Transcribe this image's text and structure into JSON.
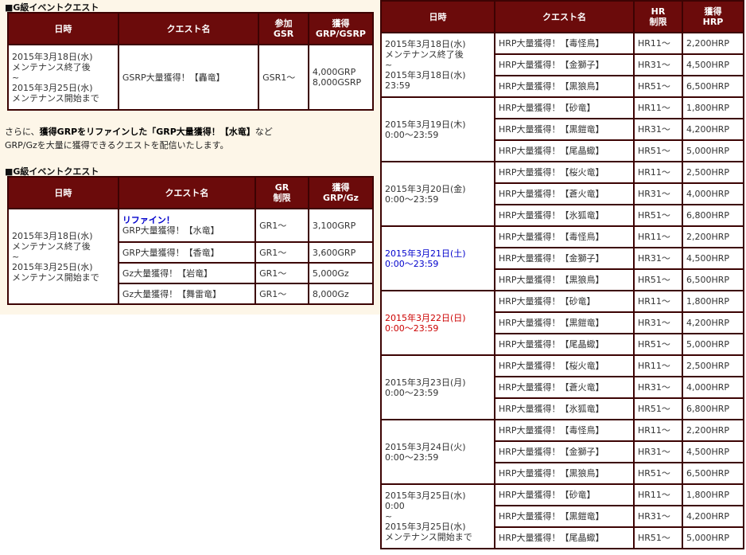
{
  "left": {
    "section1_title": "■G級イベントクエスト",
    "table1": {
      "headers": {
        "date": "日時",
        "quest": "クエスト名",
        "cond_line1": "参加",
        "cond_line2": "GSR",
        "reward_line1": "獲得",
        "reward_line2": "GRP/GSRP"
      },
      "row": {
        "date_lines": [
          "2015年3月18日(水)",
          "メンテナンス終了後",
          "~",
          "2015年3月25日(水)",
          "メンテナンス開始まで"
        ],
        "quest": "GSRP大量獲得！【轟竜】",
        "cond": "GSR1～",
        "reward_lines": [
          "4,000GRP",
          "8,000GSRP"
        ]
      }
    },
    "note": {
      "prefix": "さらに、",
      "bold1": "獲得GRPをリファインした「GRP大量獲得！【水竜】",
      "suffix": "など",
      "line2": "GRP/Gzを大量に獲得できるクエストを配信いたします。"
    },
    "section2_title": "■G級イベントクエスト",
    "table2": {
      "headers": {
        "date": "日時",
        "quest": "クエスト名",
        "cond_line1": "GR",
        "cond_line2": "制限",
        "reward_line1": "獲得",
        "reward_line2": "GRP/Gz"
      },
      "date_lines": [
        "2015年3月18日(水)",
        "メンテナンス終了後",
        "~",
        "2015年3月25日(水)",
        "メンテナンス開始まで"
      ],
      "refine_label": "リファイン！",
      "rows": [
        {
          "quest": "GRP大量獲得！【水竜】",
          "cond": "GR1～",
          "reward": "3,100GRP"
        },
        {
          "quest": "GRP大量獲得！【香竜】",
          "cond": "GR1～",
          "reward": "3,600GRP"
        },
        {
          "quest": "Gz大量獲得！【岩竜】",
          "cond": "GR1～",
          "reward": "5,000Gz"
        },
        {
          "quest": "Gz大量獲得！【舞雷竜】",
          "cond": "GR1～",
          "reward": "8,000Gz"
        }
      ]
    }
  },
  "right": {
    "headers": {
      "date": "日時",
      "quest": "クエスト名",
      "cond_line1": "HR",
      "cond_line2": "制限",
      "reward_line1": "獲得",
      "reward_line2": "HRP"
    },
    "days": [
      {
        "date_lines": [
          "2015年3月18日(水)",
          "メンテナンス終了後",
          "~",
          "2015年3月18日(水)",
          "23:59"
        ],
        "color": "#333333",
        "quests": [
          {
            "quest": "HRP大量獲得！【毒怪鳥】",
            "cond": "HR11～",
            "reward": "2,200HRP"
          },
          {
            "quest": "HRP大量獲得！【金獅子】",
            "cond": "HR31～",
            "reward": "4,500HRP"
          },
          {
            "quest": "HRP大量獲得！【黒狼鳥】",
            "cond": "HR51～",
            "reward": "6,500HRP"
          }
        ]
      },
      {
        "date_lines": [
          "2015年3月19日(木)",
          "0:00～23:59"
        ],
        "color": "#333333",
        "quests": [
          {
            "quest": "HRP大量獲得！【砂竜】",
            "cond": "HR11～",
            "reward": "1,800HRP"
          },
          {
            "quest": "HRP大量獲得！【黒鎧竜】",
            "cond": "HR31～",
            "reward": "4,200HRP"
          },
          {
            "quest": "HRP大量獲得！【尾晶蠍】",
            "cond": "HR51～",
            "reward": "5,000HRP"
          }
        ]
      },
      {
        "date_lines": [
          "2015年3月20日(金)",
          "0:00～23:59"
        ],
        "color": "#333333",
        "quests": [
          {
            "quest": "HRP大量獲得！【桜火竜】",
            "cond": "HR11～",
            "reward": "2,500HRP"
          },
          {
            "quest": "HRP大量獲得！【蒼火竜】",
            "cond": "HR31～",
            "reward": "4,000HRP"
          },
          {
            "quest": "HRP大量獲得！【氷狐竜】",
            "cond": "HR51～",
            "reward": "6,800HRP"
          }
        ]
      },
      {
        "date_lines": [
          "2015年3月21日(土)",
          "0:00～23:59"
        ],
        "color": "#0000cc",
        "quests": [
          {
            "quest": "HRP大量獲得！【毒怪鳥】",
            "cond": "HR11～",
            "reward": "2,200HRP"
          },
          {
            "quest": "HRP大量獲得！【金獅子】",
            "cond": "HR31～",
            "reward": "4,500HRP"
          },
          {
            "quest": "HRP大量獲得！【黒狼鳥】",
            "cond": "HR51～",
            "reward": "6,500HRP"
          }
        ]
      },
      {
        "date_lines": [
          "2015年3月22日(日)",
          "0:00～23:59"
        ],
        "color": "#cc0000",
        "quests": [
          {
            "quest": "HRP大量獲得！【砂竜】",
            "cond": "HR11～",
            "reward": "1,800HRP"
          },
          {
            "quest": "HRP大量獲得！【黒鎧竜】",
            "cond": "HR31～",
            "reward": "4,200HRP"
          },
          {
            "quest": "HRP大量獲得！【尾晶蠍】",
            "cond": "HR51～",
            "reward": "5,000HRP"
          }
        ]
      },
      {
        "date_lines": [
          "2015年3月23日(月)",
          "0:00～23:59"
        ],
        "color": "#333333",
        "quests": [
          {
            "quest": "HRP大量獲得！【桜火竜】",
            "cond": "HR11～",
            "reward": "2,500HRP"
          },
          {
            "quest": "HRP大量獲得！【蒼火竜】",
            "cond": "HR31～",
            "reward": "4,000HRP"
          },
          {
            "quest": "HRP大量獲得！【氷狐竜】",
            "cond": "HR51～",
            "reward": "6,800HRP"
          }
        ]
      },
      {
        "date_lines": [
          "2015年3月24日(火)",
          "0:00～23:59"
        ],
        "color": "#333333",
        "quests": [
          {
            "quest": "HRP大量獲得！【毒怪鳥】",
            "cond": "HR11～",
            "reward": "2,200HRP"
          },
          {
            "quest": "HRP大量獲得！【金獅子】",
            "cond": "HR31～",
            "reward": "4,500HRP"
          },
          {
            "quest": "HRP大量獲得！【黒狼鳥】",
            "cond": "HR51～",
            "reward": "6,500HRP"
          }
        ]
      },
      {
        "date_lines": [
          "2015年3月25日(水)",
          "0:00",
          "~",
          "2015年3月25日(水)",
          "メンテナンス開始まで"
        ],
        "color": "#333333",
        "quests": [
          {
            "quest": "HRP大量獲得！【砂竜】",
            "cond": "HR11～",
            "reward": "1,800HRP"
          },
          {
            "quest": "HRP大量獲得！【黒鎧竜】",
            "cond": "HR31～",
            "reward": "4,200HRP"
          },
          {
            "quest": "HRP大量獲得！【尾晶蠍】",
            "cond": "HR51～",
            "reward": "5,000HRP"
          }
        ]
      }
    ]
  }
}
